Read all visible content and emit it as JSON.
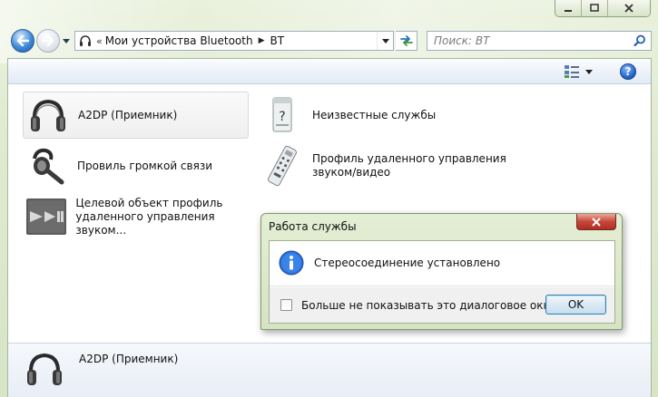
{
  "window": {
    "minimize_icon": "minimize-icon",
    "maximize_icon": "maximize-icon",
    "close_icon": "close-icon"
  },
  "navigation": {
    "breadcrumb": [
      "Мои устройства Bluetooth",
      "BT"
    ],
    "search_placeholder": "Поиск: BT"
  },
  "items": [
    {
      "label": "A2DP (Приемник)",
      "icon": "headphones-icon",
      "selected": true
    },
    {
      "label": "Неизвестные службы",
      "icon": "unknown-service-icon"
    },
    {
      "label": "Провиль громкой связи",
      "icon": "bluetooth-headset-icon"
    },
    {
      "label_line1": "Профиль удаленного управления",
      "label_line2": "звуком/видео",
      "icon": "remote-control-icon"
    },
    {
      "label_line1": "Целевой объект  профиль",
      "label_line2": "удаленного управления звуком...",
      "icon": "play-pause-icon"
    }
  ],
  "details": {
    "label": "A2DP (Приемник)"
  },
  "dialog": {
    "title": "Работа службы",
    "message": "Стереосоединение установлено",
    "checkbox_label": "Больше не показывать это диалоговое окно",
    "checkbox_checked": false,
    "ok_label": "OK"
  },
  "colors": {
    "frame": "#dfe9cf",
    "accent": "#1d5fc4",
    "dialog_close": "#c7463a"
  }
}
